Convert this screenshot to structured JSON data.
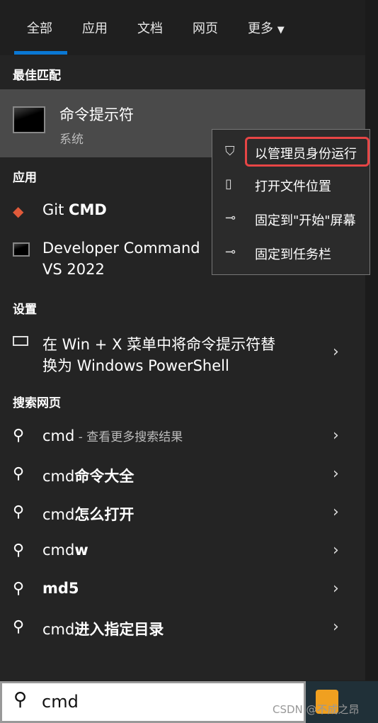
{
  "tabs": [
    "全部",
    "应用",
    "文档",
    "网页",
    "更多"
  ],
  "best_match": {
    "header": "最佳匹配",
    "title": "命令提示符",
    "subtitle": "系统"
  },
  "apps": {
    "header": "应用",
    "items": [
      {
        "label": "Git ",
        "bold": "CMD"
      },
      {
        "label": "Developer Command",
        "line2": "VS 2022"
      }
    ]
  },
  "settings": {
    "header": "设置",
    "line1": "在 Win + X 菜单中将命令提示符替",
    "line2": "换为 Windows PowerShell"
  },
  "web": {
    "header": "搜索网页",
    "items": [
      {
        "prefix": "cmd",
        "suffix": " - 查看更多搜索结果",
        "bold": ""
      },
      {
        "prefix": "cmd",
        "bold": "命令大全"
      },
      {
        "prefix": "cmd",
        "bold": "怎么打开"
      },
      {
        "prefix": "cmd",
        "bold": "w"
      },
      {
        "prefix": "",
        "bold": "md5"
      },
      {
        "prefix": "cmd",
        "bold": "进入指定目录"
      }
    ]
  },
  "context_menu": [
    "以管理员身份运行",
    "打开文件位置",
    "固定到\"开始\"屏幕",
    "固定到任务栏"
  ],
  "search": {
    "value": "cmd"
  },
  "watermark": "CSDN @不成之昂",
  "colors": {
    "accent": "#0a78d4",
    "highlight_box": "#e74545"
  }
}
